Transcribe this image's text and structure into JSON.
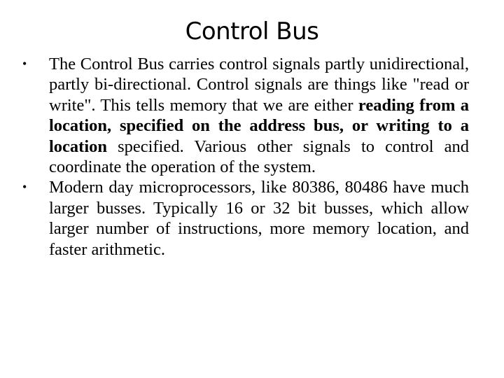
{
  "slide": {
    "title": "Control Bus",
    "bullets": [
      {
        "marker": "•",
        "seg1": "The Control Bus carries control signals partly unidirectional, partly bi-directional. Control signals are things like \"read or write\". This tells memory that we are either ",
        "bold": "reading from a location, specified on the address bus, or writing to a location",
        "seg2": " specified. Various other signals to control and coordinate the operation of the system."
      },
      {
        "marker": "•",
        "text": "Modern day microprocessors, like 80386, 80486 have much larger busses. Typically 16 or 32 bit busses,  which allow larger number of instructions, more memory location, and faster arithmetic."
      }
    ]
  }
}
